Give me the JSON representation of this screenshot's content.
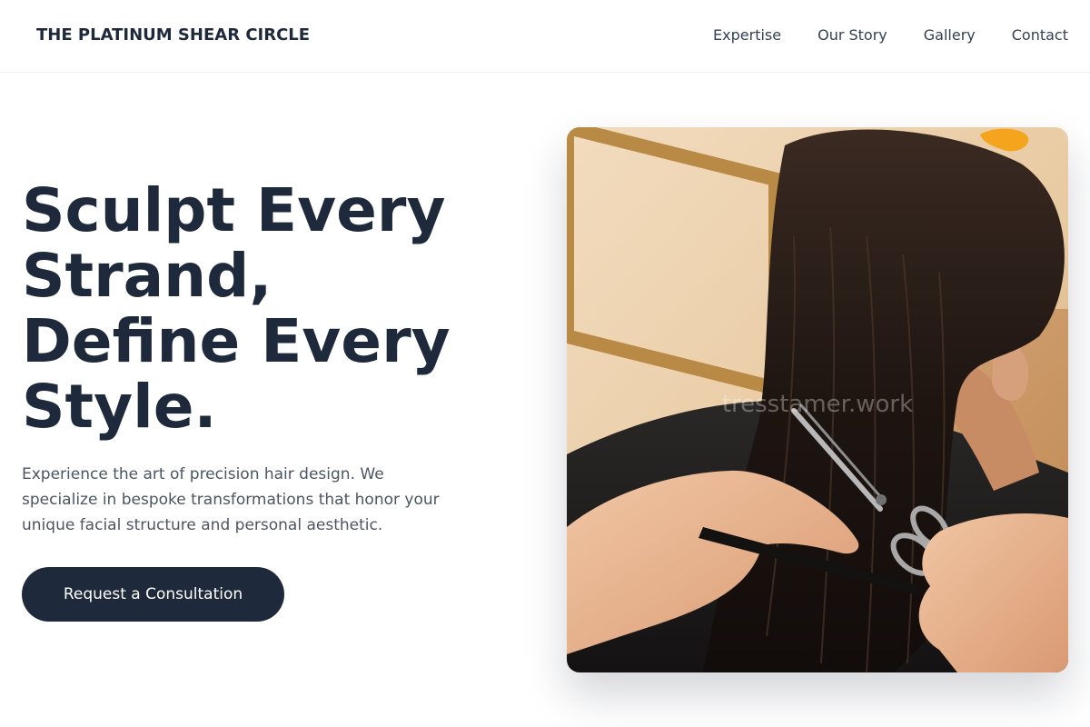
{
  "header": {
    "brand": "THE PLATINUM SHEAR CIRCLE",
    "nav": [
      "Expertise",
      "Our Story",
      "Gallery",
      "Contact"
    ]
  },
  "hero": {
    "title_lines": [
      "Sculpt Every",
      "Strand,",
      "Define Every",
      "Style."
    ],
    "description_lines": [
      "Experience the art of precision hair design. We",
      "specialize in bespoke transformations that honor your",
      "unique facial structure and personal aesthetic."
    ],
    "cta_label": "Request a Consultation"
  },
  "photo": {
    "watermark": "tresstamer.work"
  },
  "colors": {
    "text_dark": "#1e293b",
    "text_muted": "#4b5563",
    "button_bg": "#1e293b"
  }
}
